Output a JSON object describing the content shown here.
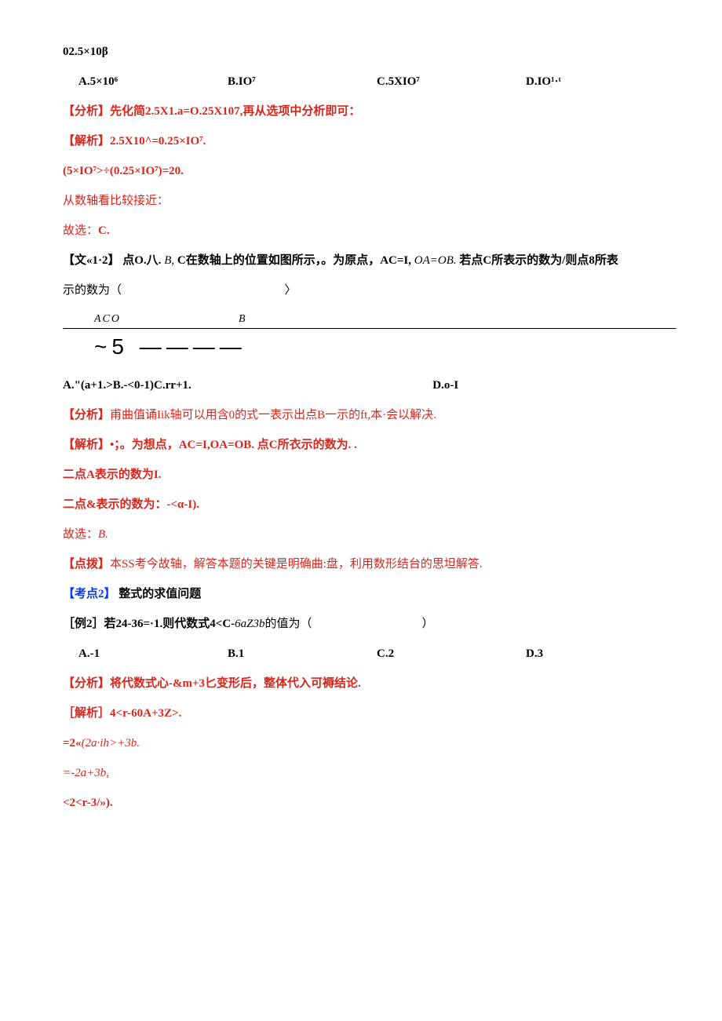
{
  "header": {
    "top_expr": "02.5×10β"
  },
  "q1": {
    "optA": "A.5×10⁶",
    "optB": "B.IO⁷",
    "optC": "C.5XIO⁷",
    "optD": "D.IO¹·ᵗ",
    "analysis_label": "【分析】",
    "analysis_text": "先化简2.5X1.a=O.25X107,再从选项中分析即可：",
    "solution_label": "【解析】",
    "solution_line1": "2.5X10^=0.25×IO⁷.",
    "solution_line2": "(5×IO⁷>÷(0.25×IO⁷)=20.",
    "note1": "从数轴看比较接近：",
    "conclusion": "故选：C."
  },
  "q2": {
    "prompt_label": "【文«1·2】",
    "prompt_text_a": "点O.八.",
    "prompt_text_b": "B,",
    "prompt_text_c": "C在数轴上的位置如图所示，。为原点，AC=I,",
    "prompt_text_d": "OA=OB.",
    "prompt_text_e": "若点C所表示的数为/则点8所表",
    "prompt_text_f": "示的数为（",
    "prompt_close": "〉",
    "axis_labels": "ACO",
    "axis_label_b": "B",
    "tick_repr": "~5 ————",
    "optA": "A.\"(a+1.>",
    "optB": "B.-<0-1)",
    "optC": "C.rr+1.",
    "optD": "D.o-I",
    "analysis_label": "【分析】",
    "analysis_text": "甫曲值诵Iik轴可以用含0的式一表示出点B一示的ft,本·会以解决.",
    "solution_label": "【解析】",
    "solution_text": "•；。为想点，AC=I,OA=OB. 点C所衣示的数为. .",
    "line_a": "二点A表示的数为I.",
    "line_b": "二点&表示的数为：-<α-I).",
    "conclusion_label": "故选：",
    "conclusion_val": "B.",
    "dianbo_label": "【点拨】",
    "dianbo_text": "本SS考今故轴，解答本题的关键是明确曲:盘，利用数形结台的思坦解答."
  },
  "kaodian2": {
    "label": "【考点2】",
    "title": "整式的求值问题"
  },
  "ex2": {
    "prompt_a": "［例2］若24-36=·1.则代数式4<C-",
    "prompt_b": "6aZ3b",
    "prompt_c": "的值为（",
    "prompt_close": "）",
    "optA": "A.-1",
    "optB": "B.1",
    "optC": "C.2",
    "optD": "D.3",
    "analysis_label": "【分析】",
    "analysis_text": "将代数式心-&m+3匕变形后，整体代入可褥结论.",
    "solution_label": "［解析］",
    "solution_text": "4<r-60A+3Z>.",
    "step1": "=2«",
    "step1b": "(2a·ih>+3b.",
    "step2": "=-2a+3b,",
    "step3": "<2<r-3/»)."
  }
}
